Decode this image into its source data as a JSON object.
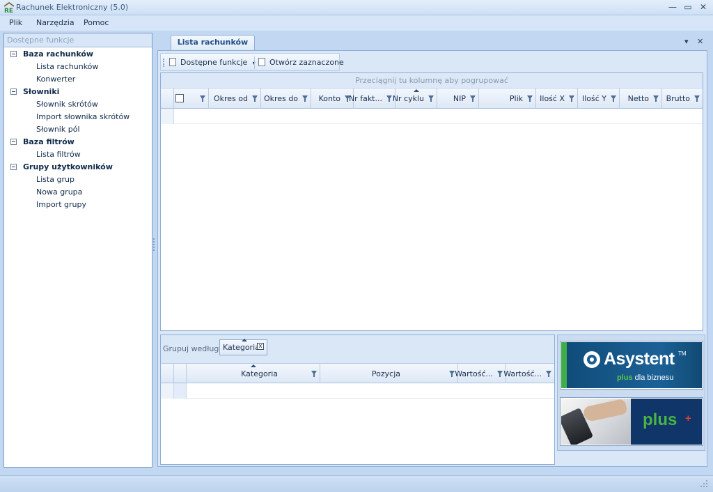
{
  "window": {
    "title": "Rachunek Elektroniczny (5.0)",
    "app_icon": "RE",
    "controls": {
      "minimize": "—",
      "maximize": "▭",
      "close": "✕"
    }
  },
  "menu": [
    "Plik",
    "Narzędzia",
    "Pomoc"
  ],
  "sidebar": {
    "header": "Dostępne funkcje",
    "groups": [
      {
        "label": "Baza rachunków",
        "items": [
          "Lista rachunków",
          "Konwerter"
        ]
      },
      {
        "label": "Słowniki",
        "items": [
          "Słownik skrótów",
          "Import słownika skrótów",
          "Słownik pól"
        ]
      },
      {
        "label": "Baza filtrów",
        "items": [
          "Lista filtrów"
        ]
      },
      {
        "label": "Grupy użytkowników",
        "items": [
          "Lista grup",
          "Nowa grupa",
          "Import grupy"
        ]
      }
    ]
  },
  "document": {
    "tab_label": "Lista rachunków",
    "tab_dropdown": "▾",
    "tab_close": "✕"
  },
  "toolbar": {
    "functions_label": "Dostępne funkcje",
    "dropdown_arrow": "▾",
    "open_selected_label": "Otwórz zaznaczone"
  },
  "main_grid": {
    "group_panel_hint": "Przeciągnij tu kolumnę aby pogrupować",
    "columns": [
      "Okres od",
      "Okres do",
      "Konto",
      "Nr fakt...",
      "Nr cyklu",
      "NIP",
      "Plik",
      "Ilość X",
      "Ilość Y",
      "Netto",
      "Brutto"
    ],
    "sorted_column": "Nr cyklu"
  },
  "detail_grid": {
    "group_by_label": "Grupuj według:",
    "group_by_chip": "Kategoria",
    "chip_close": "x",
    "columns": [
      "Kategoria",
      "Pozycja",
      "Wartość...",
      "Wartość..."
    ],
    "sorted_column": "Kategoria"
  },
  "ads": {
    "asystent_title": "Asystent",
    "asystent_tm": "TM",
    "asystent_sub_plus": "plus",
    "asystent_sub_rest": " dla biznesu",
    "plus_logo": "plus",
    "plus_mark": "+"
  },
  "colors": {
    "accent": "#1f4f87",
    "background": "#c2d8f2",
    "plus_green": "#49b544"
  }
}
